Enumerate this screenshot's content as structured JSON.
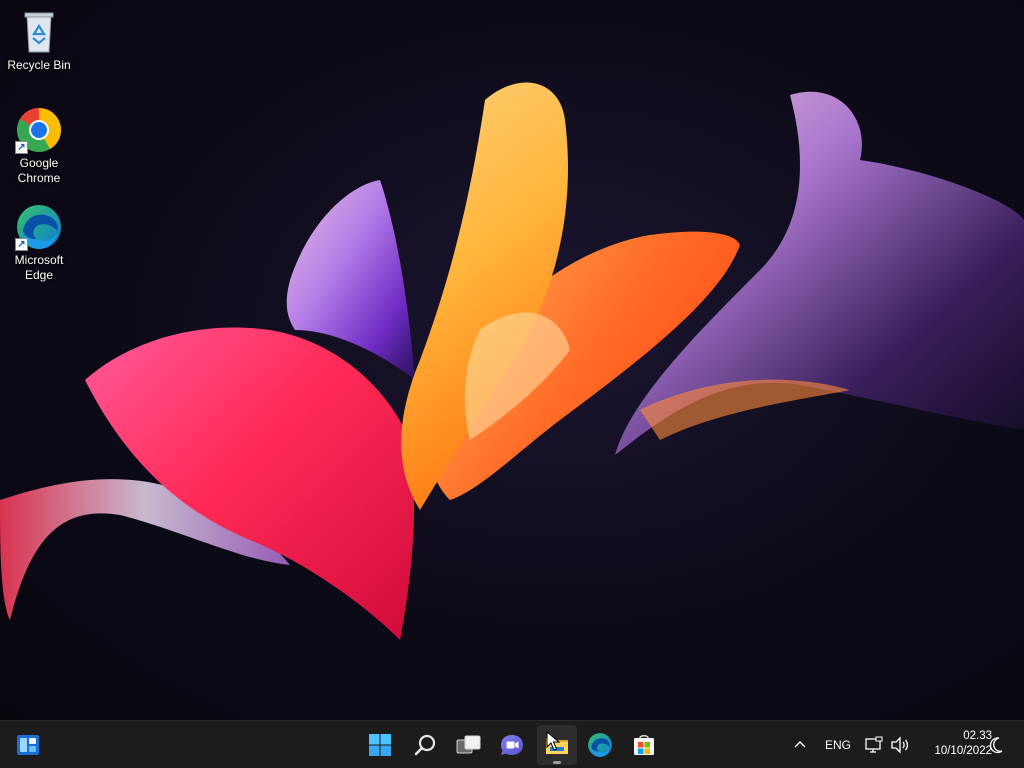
{
  "desktop": {
    "icons": [
      {
        "label": "Recycle Bin",
        "icon": "recycle-bin-icon"
      },
      {
        "label": "Google\nChrome",
        "icon": "chrome-icon"
      },
      {
        "label": "Microsoft\nEdge",
        "icon": "edge-icon"
      }
    ]
  },
  "taskbar": {
    "widgets_icon": "widgets-icon",
    "pinned": [
      {
        "name": "Start",
        "icon": "windows-start-icon"
      },
      {
        "name": "Search",
        "icon": "search-icon"
      },
      {
        "name": "Task View",
        "icon": "task-view-icon"
      },
      {
        "name": "Chat",
        "icon": "chat-icon"
      },
      {
        "name": "File Explorer",
        "icon": "file-explorer-icon"
      },
      {
        "name": "Microsoft Edge",
        "icon": "edge-icon"
      },
      {
        "name": "Microsoft Store",
        "icon": "store-icon"
      }
    ],
    "tray": {
      "language": "ENG",
      "time": "02.33",
      "date": "10/10/2022"
    }
  },
  "colors": {
    "taskbar_bg": "#1c1c1c",
    "windows_blue": "#4cc2ff",
    "edge_blue": "#0c7bd6",
    "edge_green": "#35c16a"
  }
}
